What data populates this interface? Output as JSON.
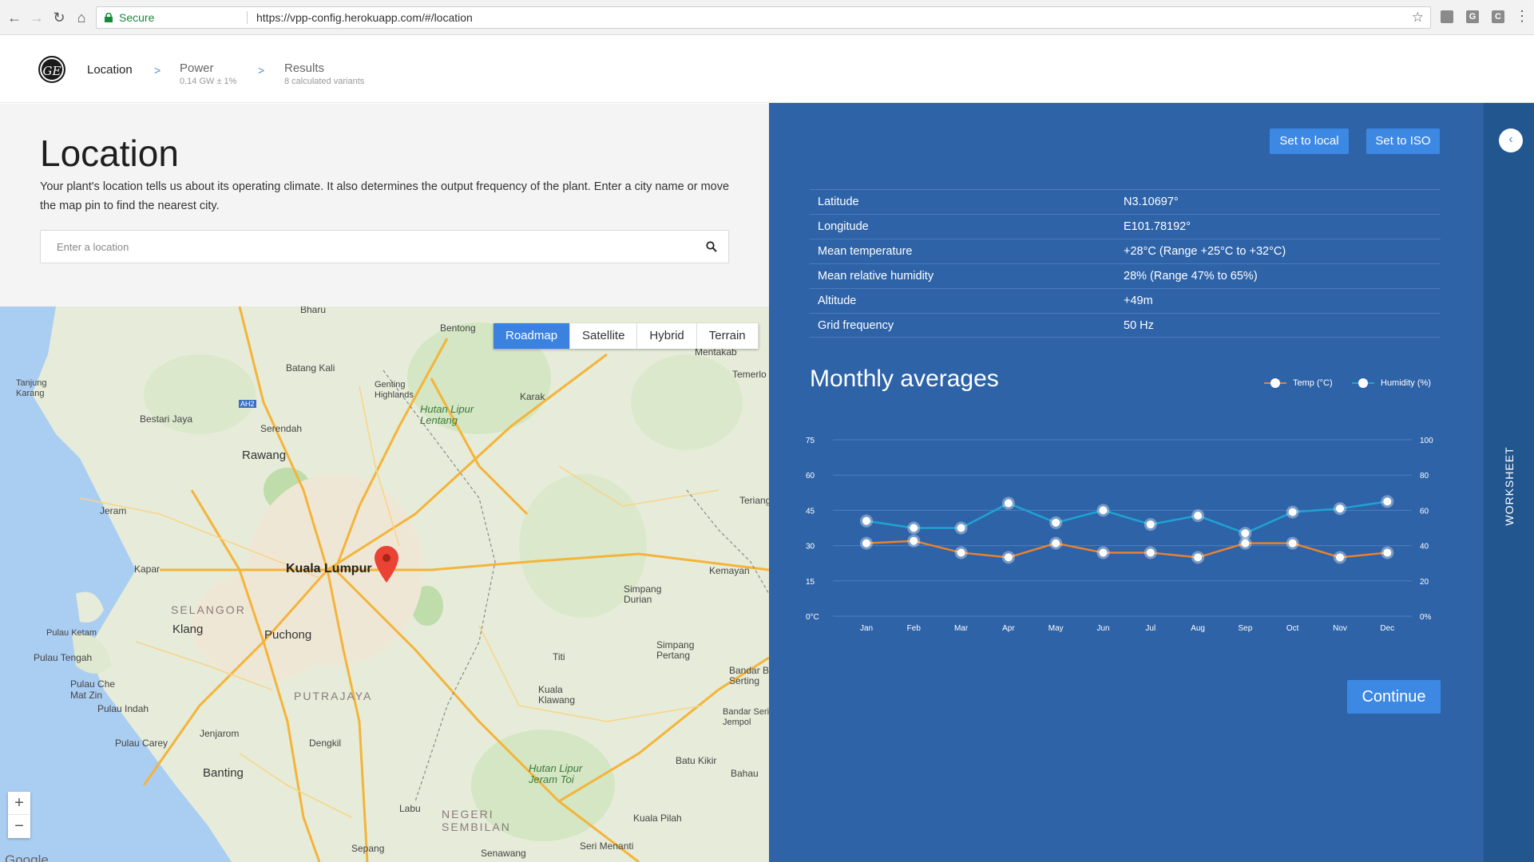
{
  "browser": {
    "secure_label": "Secure",
    "url": "https://vpp-config.herokuapp.com/#/location"
  },
  "header": {
    "logo_text": "GE",
    "steps": [
      {
        "title": "Location",
        "sub": ""
      },
      {
        "title": "Power",
        "sub": "0.14 GW ± 1%"
      },
      {
        "title": "Results",
        "sub": "8 calculated variants"
      }
    ],
    "separator": ">"
  },
  "location_section": {
    "title": "Location",
    "description": "Your plant's location tells us about its operating climate. It also determines the output frequency of the plant. Enter a city name or move the map pin to find the nearest city.",
    "search_placeholder": "Enter a location"
  },
  "map": {
    "map_types": [
      "Roadmap",
      "Satellite",
      "Hybrid",
      "Terrain"
    ],
    "active_map_type": "Roadmap",
    "zoom_in": "+",
    "zoom_out": "−",
    "attribution": "Google",
    "labels": {
      "kuala_lumpur": "Kuala Lumpur",
      "klang": "Klang",
      "puchong": "Puchong",
      "rawang": "Rawang",
      "selangor": "SELANGOR",
      "putrajaya": "PUTRAJAYA",
      "negeri_sembilan": "NEGERI\nSEMBILAN",
      "bentong": "Bentong",
      "batang_kali": "Batang Kali",
      "genting": "Genting\nHighlands",
      "serendah": "Serendah",
      "bestari_jaya": "Bestari Jaya",
      "jeram": "Jeram",
      "kapar": "Kapar",
      "tanjung_karang": "Tanjung\nKarang",
      "pulau_ketam": "Pulau Ketam",
      "pulau_tengah": "Pulau Tengah",
      "pulau_che_mat_zin": "Pulau Che\nMat Zin",
      "pulau_indah": "Pulau Indah",
      "jenjarom": "Jenjarom",
      "pulau_carey": "Pulau Carey",
      "banting": "Banting",
      "dengkil": "Dengkil",
      "labu": "Labu",
      "sepang": "Sepang",
      "karak": "Karak",
      "mentakab": "Mentakab",
      "temerloh": "Temerlo",
      "teriang": "Teriang",
      "kemayan": "Kemayan",
      "simpang_durian": "Simpang\nDurian",
      "simpang_pertang": "Simpang\nPertang",
      "titi": "Titi",
      "kuala_klawang": "Kuala\nKlawang",
      "batu_kikir": "Batu Kikir",
      "bahau": "Bahau",
      "kuala_pilah": "Kuala Pilah",
      "seri_menanti": "Seri Menanti",
      "senawang": "Senawang",
      "bharu": "Bharu",
      "hutan_lentang": "Hutan Lipur\nLentang",
      "hutan_jeram_toi": "Hutan Lipur\nJeram Toi",
      "bandar_bahru": "Bandar B\nSerting",
      "bandar_seri_jempol": "Bandar Seri\nJempol",
      "ah2": "AH2"
    }
  },
  "climate": {
    "set_local_label": "Set to local",
    "set_iso_label": "Set to ISO",
    "rows": [
      {
        "key": "Latitude",
        "value": "N3.10697°"
      },
      {
        "key": "Longitude",
        "value": "E101.78192°"
      },
      {
        "key": "Mean temperature",
        "value": "+28°C (Range +25°C to +32°C)"
      },
      {
        "key": "Mean relative humidity",
        "value": "28% (Range 47% to 65%)"
      },
      {
        "key": "Altitude",
        "value": "+49m"
      },
      {
        "key": "Grid frequency",
        "value": "50 Hz"
      }
    ],
    "chart_title": "Monthly averages",
    "continue_label": "Continue"
  },
  "worksheet": {
    "label": "WORKSHEET",
    "collapse_icon": "‹"
  },
  "colors": {
    "panel_blue": "#2e63a8",
    "accent_blue": "#3d88e3",
    "temp_line": "#e8822f",
    "humidity_line": "#1fa3d1"
  },
  "chart_data": {
    "type": "line",
    "title": "Monthly averages",
    "categories": [
      "Jan",
      "Feb",
      "Mar",
      "Apr",
      "May",
      "Jun",
      "Jul",
      "Aug",
      "Sep",
      "Oct",
      "Nov",
      "Dec"
    ],
    "y_left": {
      "ticks": [
        "0°C",
        "15",
        "30",
        "45",
        "60",
        "75"
      ],
      "range": [
        0,
        75
      ]
    },
    "y_right": {
      "ticks": [
        "0%",
        "20",
        "40",
        "60",
        "80",
        "100"
      ],
      "range": [
        0,
        100
      ]
    },
    "series": [
      {
        "name": "Temp (°C)",
        "axis": "left",
        "color": "#e8822f",
        "values": [
          31,
          32,
          27,
          25,
          31,
          27,
          27,
          25,
          31,
          31,
          25,
          27
        ]
      },
      {
        "name": "Humidity (%)",
        "axis": "right",
        "color": "#1fa3d1",
        "values": [
          54,
          50,
          50,
          64,
          53,
          60,
          52,
          57,
          47,
          59,
          61,
          65
        ]
      }
    ],
    "legend_position": "top-right",
    "grid": true
  }
}
